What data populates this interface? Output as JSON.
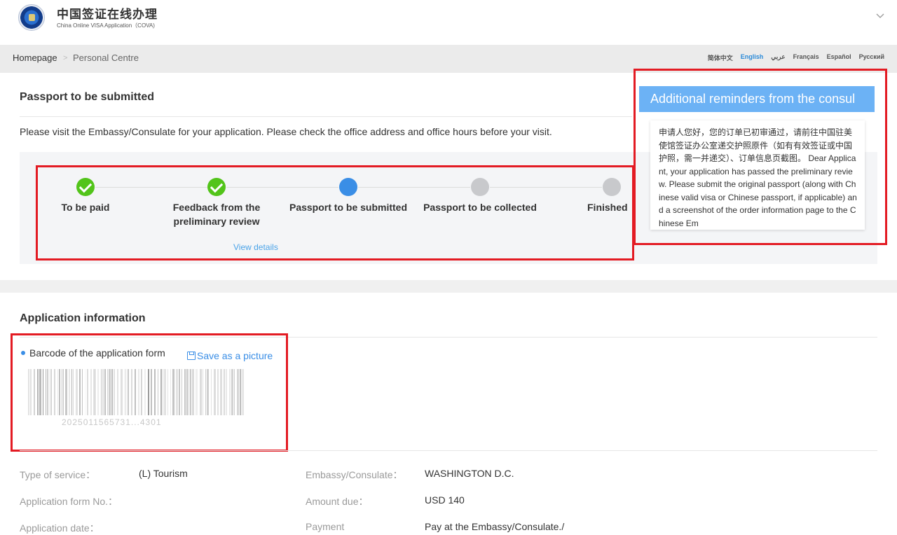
{
  "header": {
    "brand_cn": "中国签证在线办理",
    "brand_en": "China Online VISA Application（COVA)"
  },
  "breadcrumb": {
    "home": "Homepage",
    "separator": ">",
    "current": "Personal Centre"
  },
  "languages": [
    "简体中文",
    "English",
    "عربي",
    "Français",
    "Español",
    "Русский"
  ],
  "active_language": "English",
  "status_section": {
    "title": "Passport to be submitted",
    "message": "Please visit the Embassy/Consulate for your application. Please check the office address and office hours before your visit.",
    "steps": [
      {
        "label": "To be paid",
        "state": "done"
      },
      {
        "label": "Feedback from the preliminary review",
        "state": "done"
      },
      {
        "label": "Passport to be submitted",
        "state": "current"
      },
      {
        "label": "Passport to be collected",
        "state": "pending"
      },
      {
        "label": "Finished",
        "state": "pending"
      }
    ],
    "view_details": "View details"
  },
  "reminder": {
    "title": "Additional reminders from the consul",
    "body": "申请人您好，您的订单已初审通过，请前往中国驻美使馆签证办公室递交护照原件（如有有效签证或中国护照，需一并递交）、订单信息页截图。 Dear Applicant, your application has passed the preliminary review. Please submit the original passport (along with Chinese valid visa or Chinese passport, if applicable) and a screenshot of the order information page to the Chinese Em"
  },
  "application_info": {
    "title": "Application information",
    "barcode_label": "Barcode of the application form",
    "save_picture": "Save as a picture",
    "barcode_number": "2025011565731...4301",
    "fields_left": [
      {
        "label": "Type of service：",
        "value": "(L) Tourism"
      },
      {
        "label": "Application form No.：",
        "value": ""
      },
      {
        "label": "Application date：",
        "value": ""
      }
    ],
    "fields_right": [
      {
        "label": "Embassy/Consulate：",
        "value": "WASHINGTON D.C."
      },
      {
        "label": "Amount due：",
        "value": "USD 140"
      },
      {
        "label": "Payment",
        "value": "Pay at the Embassy/Consulate./"
      }
    ]
  },
  "colors": {
    "accent": "#3a8ee6",
    "success": "#52c41a",
    "pending": "#c8c9cc",
    "highlight_box": "#e31b23",
    "reminder_header": "#6cb2f5"
  }
}
